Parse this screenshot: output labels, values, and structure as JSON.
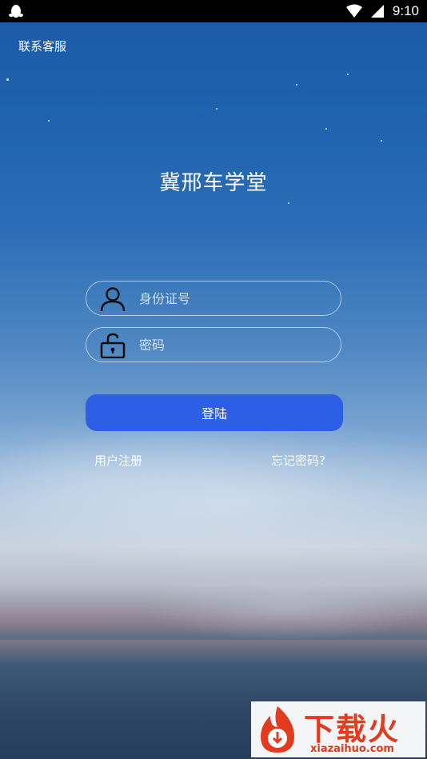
{
  "status_bar": {
    "time": "9:10",
    "left_icon": "qq-penguin-icon",
    "right_icons": [
      "wifi-icon",
      "signal-icon"
    ]
  },
  "header": {
    "contact_label": "联系客服"
  },
  "app": {
    "title": "冀邢车学堂"
  },
  "form": {
    "id_placeholder": "身份证号",
    "id_value": "",
    "id_icon": "user-icon",
    "password_placeholder": "密码",
    "password_value": "",
    "password_icon": "unlock-icon",
    "login_label": "登陆",
    "login_color": "#2c5ee6"
  },
  "links": {
    "register_label": "用户注册",
    "forgot_label": "忘记密码?"
  },
  "watermark": {
    "brand": "下载火",
    "url": "xiazaihuo.com",
    "color": "#e33b1f"
  }
}
